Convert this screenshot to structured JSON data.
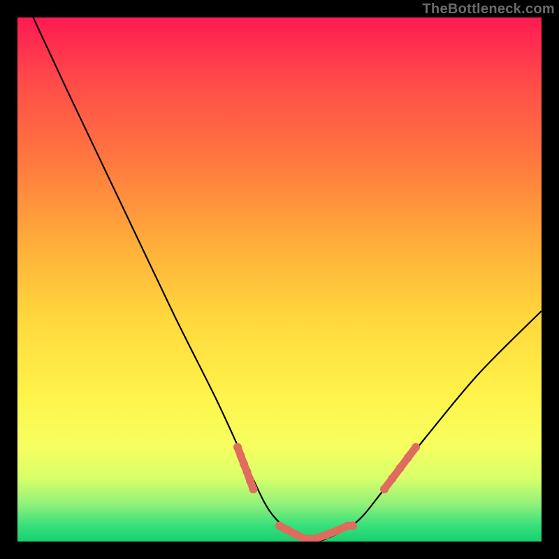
{
  "watermark": "TheBottleneck.com",
  "colors": {
    "frame": "#000000",
    "gradient_top": "#ff1a52",
    "gradient_bottom": "#18d070",
    "curve": "#000000",
    "markers": "#e06b5f"
  },
  "chart_data": {
    "type": "line",
    "title": "",
    "xlabel": "",
    "ylabel": "",
    "xlim": [
      0,
      100
    ],
    "ylim": [
      0,
      100
    ],
    "grid": false,
    "series": [
      {
        "name": "curve",
        "x": [
          3,
          10,
          20,
          30,
          38,
          44,
          48,
          52,
          56,
          60,
          65,
          70,
          78,
          88,
          100
        ],
        "y": [
          100,
          85,
          64,
          43,
          27,
          14,
          6,
          2,
          0,
          1,
          4,
          10,
          20,
          32,
          44
        ]
      }
    ],
    "marker_clusters": [
      {
        "start_x": 42,
        "end_x": 45,
        "start_y": 18,
        "end_y": 10,
        "points": [
          [
            42.0,
            18.0
          ],
          [
            42.6,
            16.4
          ],
          [
            43.2,
            14.8
          ],
          [
            43.8,
            13.3
          ],
          [
            44.4,
            11.6
          ],
          [
            45.0,
            10.0
          ]
        ]
      },
      {
        "start_x": 50,
        "end_x": 64,
        "start_y": 3,
        "end_y": 3,
        "points": [
          [
            50.0,
            3.0
          ],
          [
            51.5,
            2.2
          ],
          [
            53.0,
            1.4
          ],
          [
            55.0,
            0.5
          ],
          [
            57.0,
            0.6
          ],
          [
            59.0,
            1.3
          ],
          [
            61.0,
            2.1
          ],
          [
            63.0,
            3.0
          ],
          [
            64.0,
            3.0
          ]
        ]
      },
      {
        "start_x": 70,
        "end_x": 76,
        "start_y": 10,
        "end_y": 18,
        "points": [
          [
            70.0,
            10.0
          ],
          [
            71.5,
            12.0
          ],
          [
            73.0,
            14.0
          ],
          [
            74.5,
            16.0
          ],
          [
            76.0,
            18.0
          ]
        ]
      }
    ]
  }
}
